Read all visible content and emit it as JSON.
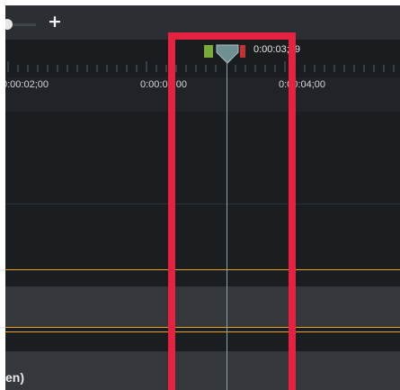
{
  "toolbar": {
    "zoom_plus_label": "+"
  },
  "ruler": {
    "labels": [
      "0:00:02;00",
      "0:00:03;00",
      "0:00:04;00"
    ]
  },
  "playhead": {
    "time_readout": "0:00:03;19"
  },
  "tracks": {
    "bottom_track_label": "en)"
  },
  "colors": {
    "highlight": "#e5223f",
    "mark_in": "#7aab3a",
    "mark_out": "#c13232",
    "guide": "#e8a21f",
    "playhead": "#8fa3a8"
  }
}
